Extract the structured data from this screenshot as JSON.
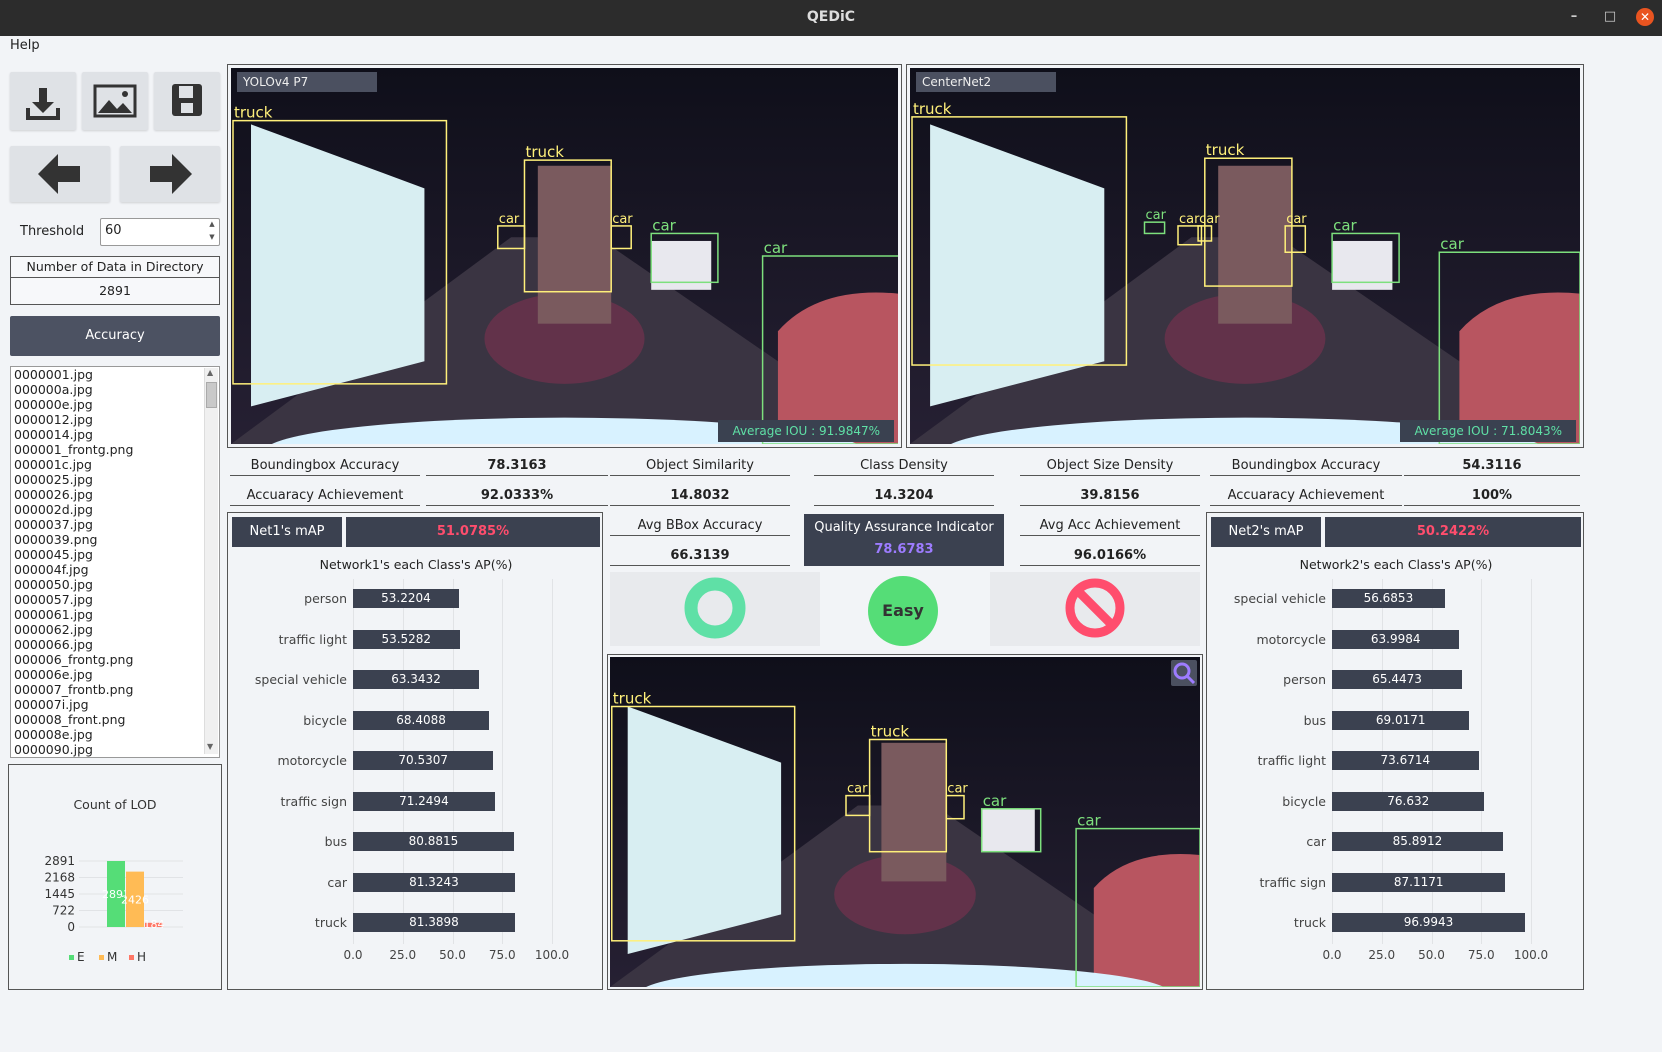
{
  "window": {
    "title": "QEDiC",
    "minimize": "–",
    "maximize": "□",
    "close": "✕"
  },
  "menu": {
    "help": "Help"
  },
  "toolbar": {
    "open_icon": "download-icon",
    "image_icon": "image-icon",
    "save_icon": "save-icon",
    "prev_icon": "arrow-left-icon",
    "next_icon": "arrow-right-icon"
  },
  "threshold": {
    "label": "Threshold",
    "value": "60"
  },
  "directory": {
    "label": "Number of Data in Directory",
    "value": "2891"
  },
  "accuracy_button": "Accuracy",
  "files": [
    "0000001.jpg",
    "000000a.jpg",
    "000000e.jpg",
    "0000012.jpg",
    "0000014.jpg",
    "000001_frontg.png",
    "000001c.jpg",
    "0000025.jpg",
    "0000026.jpg",
    "000002d.jpg",
    "0000037.jpg",
    "0000039.png",
    "0000045.jpg",
    "000004f.jpg",
    "0000050.jpg",
    "0000057.jpg",
    "0000061.jpg",
    "0000062.jpg",
    "0000066.jpg",
    "000006_frontg.png",
    "000006e.jpg",
    "000007_frontb.png",
    "000007i.jpg",
    "000008_front.png",
    "000008e.jpg",
    "0000090.jpg"
  ],
  "lod_chart": {
    "title": "Count of LOD",
    "yticks": [
      "2891",
      "2168",
      "1445",
      "722",
      "0"
    ],
    "bars": [
      {
        "label": "E",
        "value": "2891",
        "color": "#55dd77"
      },
      {
        "label": "M",
        "value": "2426",
        "color": "#ffbb55"
      },
      {
        "label": "H",
        "value": "184",
        "color": "#ff7766"
      }
    ],
    "legend": [
      "E",
      "M",
      "H"
    ]
  },
  "cam1": {
    "model": "YOLOv4 P7",
    "iou": "Average IOU : 91.9847%",
    "labels": [
      {
        "text": "truck"
      },
      {
        "text": "truck"
      },
      {
        "text": "car"
      },
      {
        "text": "car"
      },
      {
        "text": "car"
      },
      {
        "text": "car"
      }
    ]
  },
  "cam2": {
    "model": "CenterNet2",
    "iou": "Average IOU : 71.8043%",
    "labels": [
      {
        "text": "truck"
      },
      {
        "text": "truck"
      },
      {
        "text": "car"
      },
      {
        "text": "car"
      },
      {
        "text": "car"
      },
      {
        "text": "car"
      },
      {
        "text": "car"
      },
      {
        "text": "car"
      }
    ]
  },
  "cam3": {
    "labels": [
      {
        "text": "truck"
      },
      {
        "text": "truck"
      },
      {
        "text": "car"
      },
      {
        "text": "car"
      },
      {
        "text": "car"
      },
      {
        "text": "car"
      }
    ],
    "zoom_icon": "magnifier-icon"
  },
  "metrics": {
    "bbox_acc_label": "Boundingbox Accuracy",
    "bbox_acc1": "78.3163",
    "bbox_acc2": "54.3116",
    "achieve_label": "Accuaracy Achievement",
    "achieve1": "92.0333%",
    "achieve2": "100%",
    "obj_sim_label": "Object Similarity",
    "obj_sim": "14.8032",
    "class_den_label": "Class Density",
    "class_den": "14.3204",
    "size_den_label": "Object Size Density",
    "size_den": "39.8156",
    "avg_bbox_label": "Avg BBox Accuracy",
    "avg_bbox": "66.3139",
    "qai_label": "Quality Assurance Indicator",
    "qai": "78.6783",
    "avg_acc_label": "Avg Acc Achievement",
    "avg_acc": "96.0166%",
    "difficulty": "Easy"
  },
  "net1": {
    "map_label": "Net1's mAP",
    "map": "51.0785%",
    "chart_title": "Network1's each Class's AP(%)"
  },
  "net2": {
    "map_label": "Net2's mAP",
    "map": "50.2422%",
    "chart_title": "Network2's each Class's AP(%)"
  },
  "chart_data": [
    {
      "type": "bar",
      "orientation": "horizontal",
      "title": "Network1's each Class's AP(%)",
      "categories": [
        "person",
        "traffic light",
        "special vehicle",
        "bicycle",
        "motorcycle",
        "traffic sign",
        "bus",
        "car",
        "truck"
      ],
      "values": [
        53.2204,
        53.5282,
        63.3432,
        68.4088,
        70.5307,
        71.2494,
        80.8815,
        81.3243,
        81.3898
      ],
      "value_labels": [
        "53.2204",
        "53.5282",
        "63.3432",
        "68.4088",
        "70.5307",
        "71.2494",
        "80.8815",
        "81.3243",
        "81.3898"
      ],
      "xlim": [
        0,
        100
      ],
      "xticks": [
        "0.0",
        "25.0",
        "50.0",
        "75.0",
        "100.0"
      ],
      "grid": true
    },
    {
      "type": "bar",
      "orientation": "horizontal",
      "title": "Network2's each Class's AP(%)",
      "categories": [
        "special vehicle",
        "motorcycle",
        "person",
        "bus",
        "traffic light",
        "bicycle",
        "car",
        "traffic sign",
        "truck"
      ],
      "values": [
        56.6853,
        63.9984,
        65.4473,
        69.0171,
        73.6714,
        76.632,
        85.8912,
        87.1171,
        96.9943
      ],
      "value_labels": [
        "56.6853",
        "63.9984",
        "65.4473",
        "69.0171",
        "73.6714",
        "76.632",
        "85.8912",
        "87.1171",
        "96.9943"
      ],
      "xlim": [
        0,
        100
      ],
      "xticks": [
        "0.0",
        "25.0",
        "50.0",
        "75.0",
        "100.0"
      ],
      "grid": true
    },
    {
      "type": "bar",
      "title": "Count of LOD",
      "categories": [
        "E",
        "M",
        "H"
      ],
      "values": [
        2891,
        2426,
        184
      ],
      "ylim": [
        0,
        2891
      ],
      "yticks": [
        "2891",
        "2168",
        "1445",
        "722",
        "0"
      ]
    }
  ]
}
